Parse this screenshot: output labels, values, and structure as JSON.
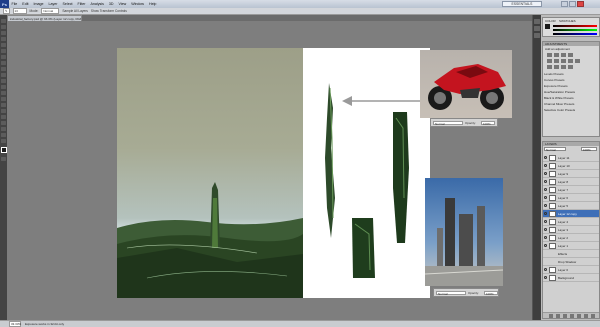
{
  "menu": {
    "app_logo": "Ps",
    "items": [
      "File",
      "Edit",
      "Image",
      "Layer",
      "Select",
      "Filter",
      "Analysis",
      "3D",
      "View",
      "Window",
      "Help"
    ],
    "workspace": "ESSENTIALS"
  },
  "options": {
    "tool_preset": "✎",
    "size": "13",
    "mode_label": "Mode:",
    "mode": "Normal",
    "sample_label": "Sample All Layers",
    "protect_label": "Show Transform Controls"
  },
  "document": {
    "tab_title": "industrial_factory.psd @ 33.3% (Layer 12 copy, RGB/8)"
  },
  "palettes": [
    {
      "mode": "Normal",
      "opacity_label": "Opacity:",
      "opacity": "100%"
    },
    {
      "mode": "Normal",
      "opacity_label": "Opacity:",
      "opacity": "100%"
    }
  ],
  "status": {
    "zoom": "33.33%",
    "info": "Exposure works in 32-bit only"
  },
  "panels": {
    "color_tab": "COLOR",
    "swatches_tab": "SWATCHES",
    "adjustments_tab": "ADJUSTMENTS",
    "add_adjustment": "Add an adjustment",
    "presets": [
      "Levels Presets",
      "Curves Presets",
      "Exposure Presets",
      "Hue/Saturation Presets",
      "Black & White Presets",
      "Channel Mixer Presets",
      "Selective Color Presets"
    ],
    "layers_tab": "LAYERS",
    "blend_mode": "Normal",
    "opacity": "100%",
    "layers": [
      "Layer 11",
      "Layer 10",
      "Layer 9",
      "Layer 8",
      "Layer 7",
      "Layer 6",
      "Layer 5",
      "Layer 12 copy",
      "Layer 4",
      "Layer 3",
      "Layer 2",
      "Layer 1",
      "Effects",
      "Drop Shadow",
      "Layer 0",
      "Background"
    ]
  },
  "colors": {
    "accent": "#3e6fb8",
    "foreground": "#1a1a1a",
    "background": "#4aa5b0"
  }
}
